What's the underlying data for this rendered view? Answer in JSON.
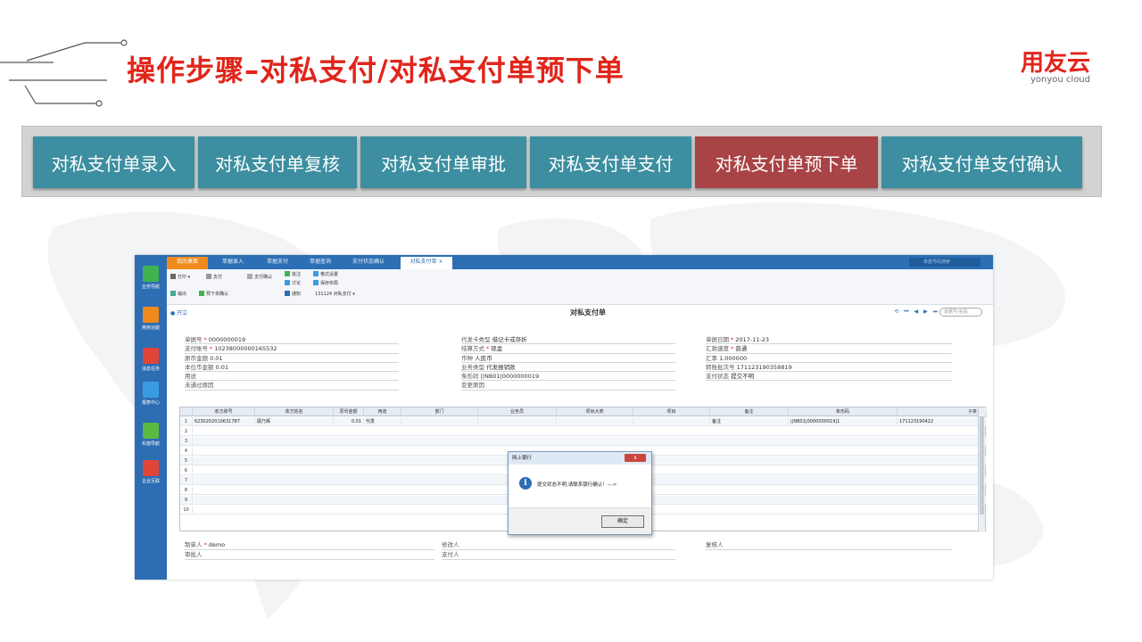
{
  "slide": {
    "title": "操作步骤–对私支付/对私支付单预下单",
    "logo_main": "用友云",
    "logo_sub": "yonyou cloud"
  },
  "steps": [
    {
      "label": "对私支付单录入",
      "active": false
    },
    {
      "label": "对私支付单复核",
      "active": false
    },
    {
      "label": "对私支付单审批",
      "active": false
    },
    {
      "label": "对私支付单支付",
      "active": false
    },
    {
      "label": "对私支付单预下单",
      "active": true
    },
    {
      "label": "对私支付单支付确认",
      "active": false
    }
  ],
  "colors": {
    "title_red": "#e1251b",
    "step_teal": "#3c8ea0",
    "step_active": "#a84346",
    "app_blue": "#2c6fb5"
  },
  "app": {
    "tabs": [
      "我的桌面",
      "单据录入",
      "单据支付",
      "单据查询",
      "支付状态确认",
      "对私支付单"
    ],
    "tab_close": "×",
    "search_placeholder": "单据号码搜索",
    "side": [
      {
        "label": "业务导航",
        "icon": "grid-icon"
      },
      {
        "label": "常用功能",
        "icon": "star-icon"
      },
      {
        "label": "消息任务",
        "icon": "mail-icon"
      },
      {
        "label": "报表中心",
        "icon": "chart-icon"
      },
      {
        "label": "实施导航",
        "icon": "compass-icon"
      },
      {
        "label": "企业互联",
        "icon": "link-icon"
      }
    ],
    "toolbar": {
      "print": "打印",
      "pay": "支付",
      "pay_confirm": "支付确认",
      "export": "输出",
      "pre_order_confirm": "预下单确认",
      "batch": "批注",
      "discuss": "讨论",
      "notify": "通知",
      "format_set": "格式设置",
      "save_layout": "保存布局",
      "template": "131124 对私支付"
    },
    "subbar": {
      "open": "开立",
      "doc_title": "对私支付单",
      "nav": "⟲ ⏮ ◀ ▶ ⏭",
      "search_placeholder": "单据号/名码"
    },
    "fields_left": [
      {
        "label": "单据号",
        "required": true,
        "value": "0000000019"
      },
      {
        "label": "支付账号",
        "required": true,
        "value": "10238000000165532"
      },
      {
        "label": "原币金额",
        "required": false,
        "value": "0.01"
      },
      {
        "label": "本位币金额",
        "required": false,
        "value": "0.01"
      },
      {
        "label": "用途",
        "required": false,
        "value": ""
      },
      {
        "label": "未通过原因",
        "required": false,
        "value": ""
      }
    ],
    "fields_mid": [
      {
        "label": "代发卡类型",
        "required": false,
        "value": "借记卡或存折"
      },
      {
        "label": "结算方式",
        "required": true,
        "value": "现金"
      },
      {
        "label": "币种",
        "required": false,
        "value": "人民币"
      },
      {
        "label": "业务类型",
        "required": false,
        "value": "代发报销款"
      },
      {
        "label": "条形码",
        "required": false,
        "value": "||NB01|0000000019"
      },
      {
        "label": "变更原因",
        "required": false,
        "value": ""
      }
    ],
    "fields_right": [
      {
        "label": "单据日期",
        "required": true,
        "value": "2017-11-23"
      },
      {
        "label": "汇款速度",
        "required": true,
        "value": "普通"
      },
      {
        "label": "汇率",
        "required": false,
        "value": "1.000000"
      },
      {
        "label": "转账批次号",
        "required": false,
        "value": "171123190358819"
      },
      {
        "label": "支付状态",
        "required": false,
        "value": "提交不明"
      }
    ],
    "grid": {
      "columns": [
        "收方账号",
        "收方姓名",
        "原币金额",
        "用途",
        "部门",
        "业务员",
        "项目大类",
        "项目",
        "备注",
        "条形码",
        "子条"
      ],
      "rows": [
        {
          "num": "1",
          "cells": [
            "6230202010631787",
            "顾乃辉",
            "0.01",
            "代发",
            "",
            "",
            "",
            "",
            "备注",
            "||NB01|0000000019|1",
            "171123190422"
          ]
        },
        {
          "num": "2",
          "cells": []
        },
        {
          "num": "3",
          "cells": []
        },
        {
          "num": "4",
          "cells": []
        },
        {
          "num": "5",
          "cells": []
        },
        {
          "num": "6",
          "cells": []
        },
        {
          "num": "7",
          "cells": []
        },
        {
          "num": "8",
          "cells": []
        },
        {
          "num": "9",
          "cells": []
        },
        {
          "num": "10",
          "cells": []
        }
      ]
    },
    "dialog": {
      "title": "网上银行",
      "message": "提交状态不明,请联系银行确认！--->",
      "ok": "确定",
      "close": "x"
    },
    "footer": {
      "maker_label": "制单人",
      "maker_value": "demo",
      "modifier_label": "修改人",
      "reviewer_label": "复核人",
      "approver_label": "审批人",
      "payer_label": "支付人"
    }
  }
}
